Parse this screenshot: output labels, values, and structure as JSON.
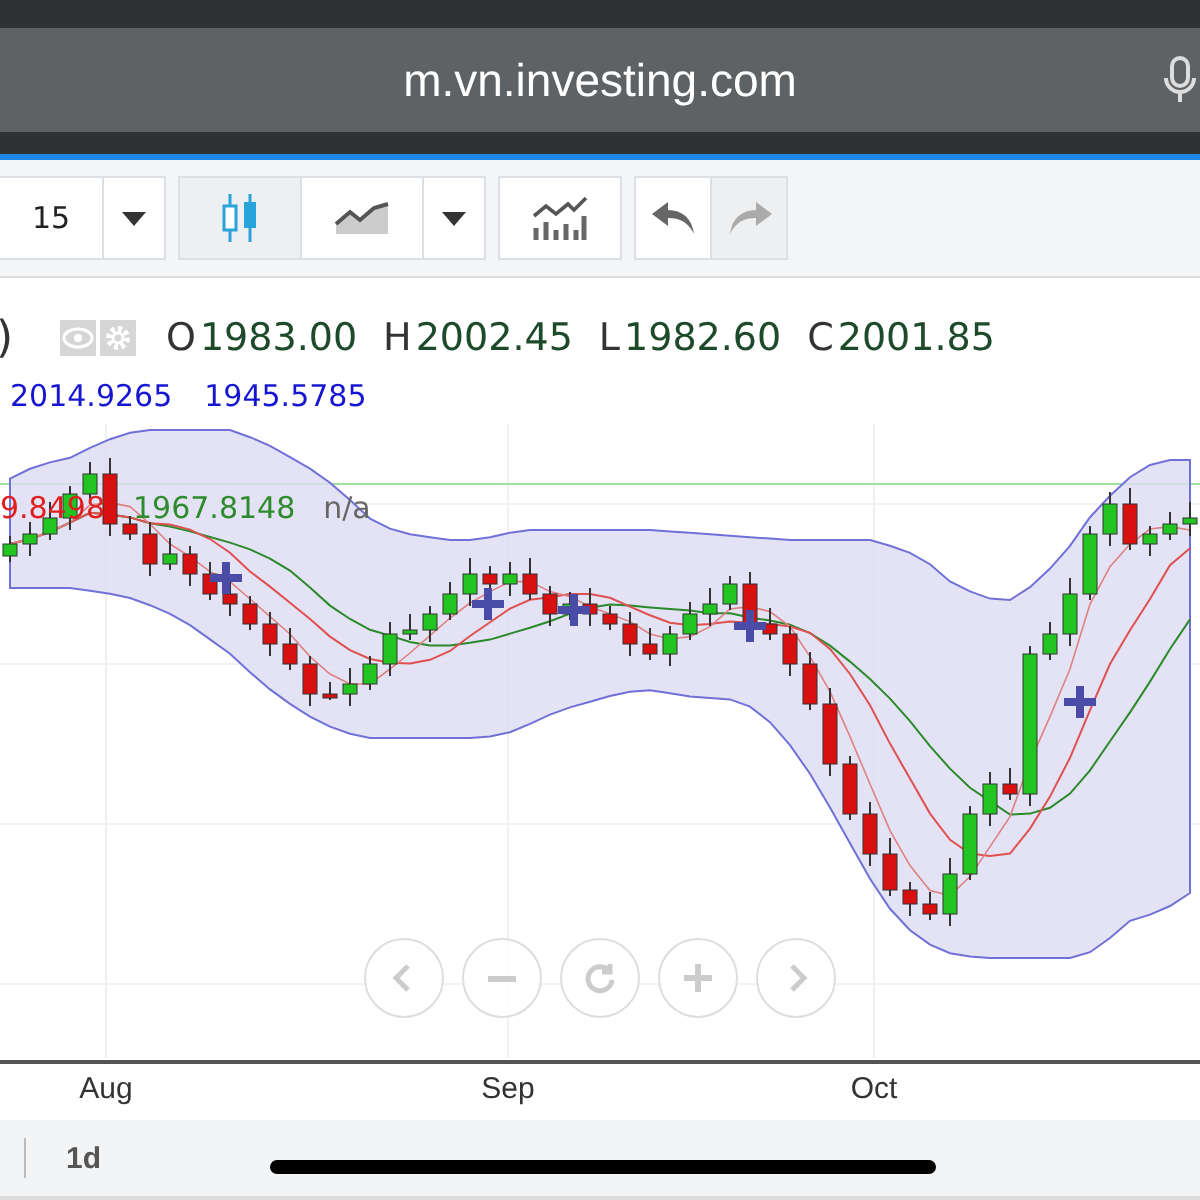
{
  "browser": {
    "url": "m.vn.investing.com"
  },
  "toolbar": {
    "interval": "15",
    "chart_types": [
      {
        "kind": "candles",
        "selected": true
      },
      {
        "kind": "area",
        "selected": false
      }
    ],
    "undo": {
      "disabled": false
    },
    "redo": {
      "disabled": true
    }
  },
  "legend": {
    "name_tail": ")",
    "ohlc": [
      {
        "label": "O",
        "value": "1983.00"
      },
      {
        "label": "H",
        "value": "2002.45"
      },
      {
        "label": "L",
        "value": "1982.60"
      },
      {
        "label": "C",
        "value": "2001.85"
      }
    ],
    "band_values": [
      "2014.9265",
      "1945.5785"
    ],
    "ma_values": [
      {
        "value": "9.8498",
        "color": "#e01e1e"
      },
      {
        "value": "1967.8148",
        "color": "#2e8b2e"
      },
      {
        "value": "n/a",
        "color": "#666666"
      }
    ]
  },
  "x_axis": [
    "Aug",
    "Sep",
    "Oct"
  ],
  "interval_bar": {
    "label": "1d"
  }
}
